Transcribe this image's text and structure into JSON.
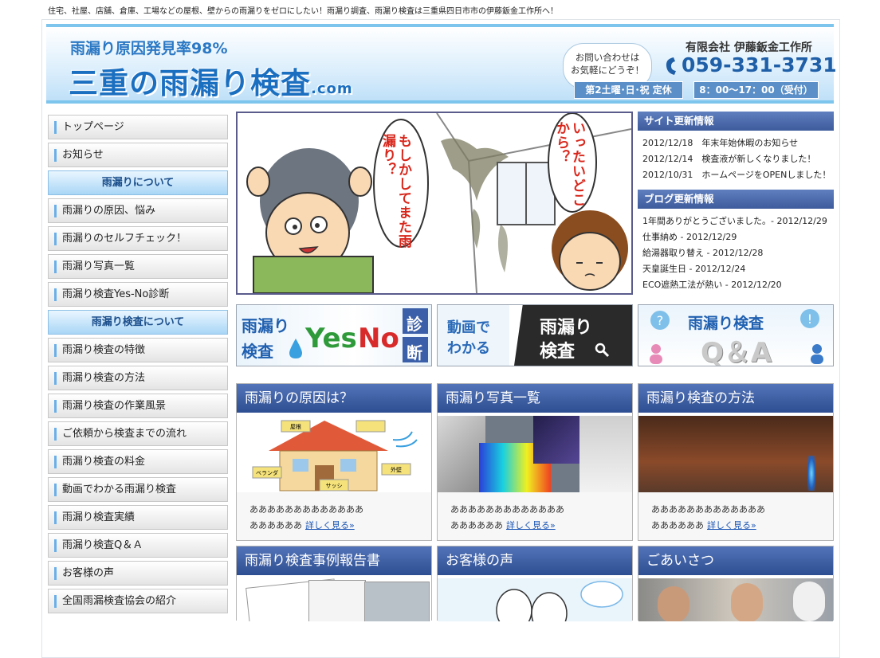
{
  "tagline": "住宅、社屋、店舗、倉庫、工場などの屋根、壁からの雨漏りをゼロにしたい！雨漏り調査、雨漏り検査は三重県四日市市の伊藤鈑金工作所へ！",
  "header": {
    "subtitle": "雨漏り原因発見率98%",
    "title": "三重の雨漏り検査",
    "title_suffix": ".com",
    "bubble_line1": "お問い合わせは",
    "bubble_line2": "お気軽にどうぞ！",
    "company": "有限会社 伊藤鈑金工作所",
    "phone": "059-331-3731",
    "closed": "第2土曜･日･祝 定休",
    "hours": "8：00〜17：00（受付）"
  },
  "sidebar": {
    "items": [
      {
        "label": "トップページ",
        "type": "link"
      },
      {
        "label": "お知らせ",
        "type": "link"
      },
      {
        "label": "雨漏りについて",
        "type": "head"
      },
      {
        "label": "雨漏りの原因、悩み",
        "type": "link"
      },
      {
        "label": "雨漏りのセルフチェック！",
        "type": "link"
      },
      {
        "label": "雨漏り写真一覧",
        "type": "link"
      },
      {
        "label": "雨漏り検査Yes-No診断",
        "type": "link"
      },
      {
        "label": "雨漏り検査について",
        "type": "head"
      },
      {
        "label": "雨漏り検査の特徴",
        "type": "link"
      },
      {
        "label": "雨漏り検査の方法",
        "type": "link"
      },
      {
        "label": "雨漏り検査の作業風景",
        "type": "link"
      },
      {
        "label": "ご依頼から検査までの流れ",
        "type": "link"
      },
      {
        "label": "雨漏り検査の料金",
        "type": "link"
      },
      {
        "label": "動画でわかる雨漏り検査",
        "type": "link"
      },
      {
        "label": "雨漏り検査実績",
        "type": "link"
      },
      {
        "label": "雨漏り検査Q＆Ａ",
        "type": "link"
      },
      {
        "label": "お客様の声",
        "type": "link"
      },
      {
        "label": "全国雨漏検査協会の紹介",
        "type": "link"
      }
    ]
  },
  "manga": {
    "speech_left": "もしかしてまた雨漏り？",
    "speech_right": "いったいどこから？"
  },
  "banners": {
    "yesno": {
      "left1": "雨漏り",
      "left2": "検査",
      "yes": "Yes",
      "no": "No",
      "right1": "診",
      "right2": "断"
    },
    "video": {
      "left1": "動画で",
      "left2": "わかる",
      "right1": "雨漏り",
      "right2": "検査"
    },
    "qa": {
      "top": "雨漏り検査",
      "main": "Q＆A"
    }
  },
  "site_updates": {
    "title": "サイト更新情報",
    "rows": [
      "2012/12/18　年末年始休暇のお知らせ",
      "2012/12/14　検査液が新しくなりました！",
      "2012/10/31　ホームページをOPENしました！"
    ]
  },
  "blog_updates": {
    "title": "ブログ更新情報",
    "rows": [
      "1年間ありがとうございました。- 2012/12/29",
      "仕事納め - 2012/12/29",
      "給湯器取り替え - 2012/12/28",
      "天皇誕生日 - 2012/12/24",
      "ECO遮熱工法が熱い - 2012/12/20"
    ]
  },
  "boxes": [
    {
      "title": "雨漏りの原因は？",
      "text1": "あああああああああああああ",
      "text2": "ああああああ",
      "link": "詳しく見る»"
    },
    {
      "title": "雨漏り写真一覧",
      "text1": "あああああああああああああ",
      "text2": "ああああああ",
      "link": "詳しく見る»"
    },
    {
      "title": "雨漏り検査の方法",
      "text1": "あああああああああああああ",
      "text2": "ああああああ",
      "link": "詳しく見る»"
    },
    {
      "title": "雨漏り検査事例報告書"
    },
    {
      "title": "お客様の声"
    },
    {
      "title": "ごあいさつ"
    }
  ],
  "house_labels": [
    "屋根",
    "ベランダ",
    "外壁",
    "サッシ"
  ],
  "colors": {
    "accent": "#1b6fc0",
    "box_head": "#3e5b9c",
    "speech": "#d8261b"
  }
}
